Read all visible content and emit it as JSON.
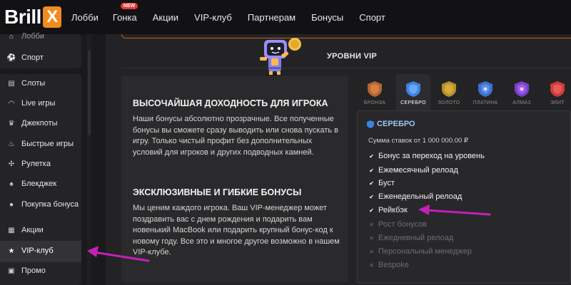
{
  "header": {
    "logo_text": "Brill",
    "logo_x": "X",
    "nav": [
      {
        "label": "Лобби"
      },
      {
        "label": "Гонка",
        "badge": "NEW"
      },
      {
        "label": "Акции"
      },
      {
        "label": "VIP-клуб"
      },
      {
        "label": "Партнерам"
      },
      {
        "label": "Бонусы"
      },
      {
        "label": "Спорт"
      }
    ]
  },
  "sidebar": {
    "items": [
      {
        "label": "Лобби",
        "icon": "lobby-icon"
      },
      {
        "label": "Спорт",
        "icon": "soccer-ball-icon"
      },
      {
        "label": "Слоты",
        "icon": "slots-icon"
      },
      {
        "label": "Live игры",
        "icon": "headset-icon"
      },
      {
        "label": "Джекпоты",
        "icon": "trophy-icon"
      },
      {
        "label": "Быстрые игры",
        "icon": "flame-icon"
      },
      {
        "label": "Рулетка",
        "icon": "roulette-icon"
      },
      {
        "label": "Блекджек",
        "icon": "blackjack-icon"
      },
      {
        "label": "Покупка бонуса",
        "icon": "coin-icon"
      },
      {
        "label": "Акции",
        "icon": "gift-icon"
      },
      {
        "label": "VIP-клуб",
        "icon": "star-icon",
        "active": true
      },
      {
        "label": "Промо",
        "icon": "promo-icon"
      }
    ]
  },
  "main": {
    "section_title": "УРОВНИ VIP",
    "heading1": "ВЫСОЧАЙШАЯ ДОХОДНОСТЬ ДЛЯ ИГРОКА",
    "text1": "Наши бонусы абсолютно прозрачные. Все полученные бонусы вы сможете сразу выводить или снова пускать в игру. Только чистый профит без дополнительных условий для игроков и других подводных камней.",
    "heading2": "ЭКСКЛЮЗИВНЫЕ И ГИБКИЕ БОНУСЫ",
    "text2": "Мы ценим каждого игрока. Ваш VIP-менеджер может поздравить вас с днем рождения и подарить вам новенький MacBook или подарить крупный бонус-код к новому году. Все это и многое другое возможно в нашем VIP-клубе."
  },
  "levels": [
    {
      "label": "БРОНЗА",
      "color": "#b5652e"
    },
    {
      "label": "СЕРЕБРО",
      "color": "#3b82e6",
      "active": true
    },
    {
      "label": "ЗОЛОТО",
      "color": "#b8902a"
    },
    {
      "label": "ПЛАТИНА",
      "color": "#3d6fd1"
    },
    {
      "label": "АЛМАЗ",
      "color": "#7b3fd0"
    },
    {
      "label": "ЭЛИТ",
      "color": "#d23a3a"
    }
  ],
  "card": {
    "title": "СЕРЕБРО",
    "subtitle": "Сумма ставок от 1 000 000.00 ₽",
    "features": [
      {
        "label": "Бонус за переход на уровень",
        "enabled": true
      },
      {
        "label": "Ежемесячный релоад",
        "enabled": true
      },
      {
        "label": "Буст",
        "enabled": true
      },
      {
        "label": "Еженедельный релоад",
        "enabled": true
      },
      {
        "label": "Рейкбэк",
        "enabled": true
      },
      {
        "label": "Рост бонусов",
        "enabled": false
      },
      {
        "label": "Ежедневный релоад",
        "enabled": false
      },
      {
        "label": "Персональный менеджер",
        "enabled": false
      },
      {
        "label": "Bespoke",
        "enabled": false
      }
    ]
  },
  "colors": {
    "brand_orange": "#f28b1e",
    "annotation_arrow": "#c51fb8"
  }
}
